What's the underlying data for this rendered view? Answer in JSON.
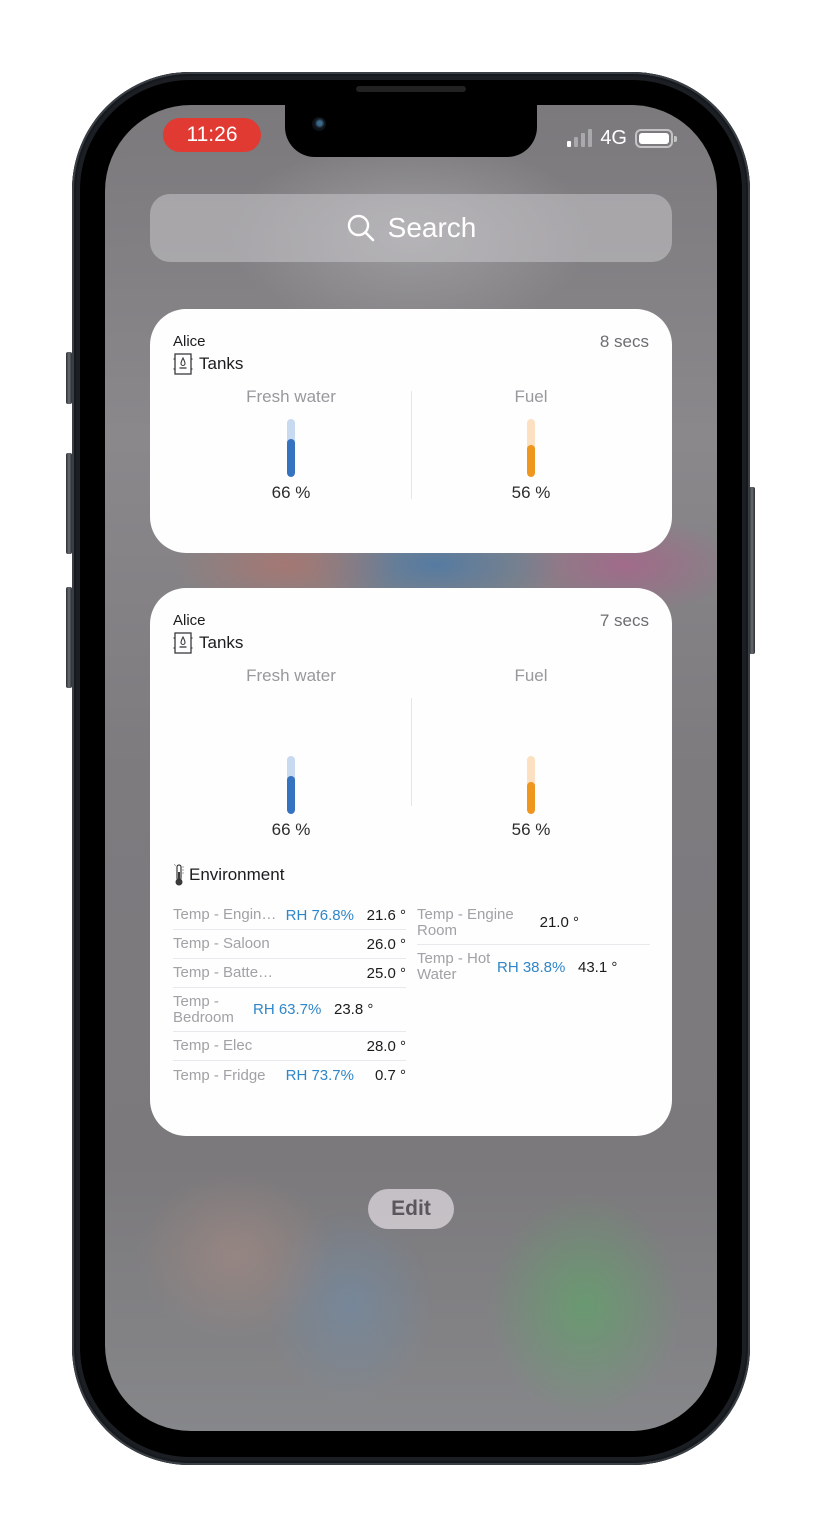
{
  "status_bar": {
    "time": "11:26",
    "network": "4G",
    "signal_bars_active": 1,
    "signal_bars_total": 4,
    "battery_level": 1.0
  },
  "search": {
    "placeholder": "Search",
    "icon": "search-icon"
  },
  "widgets": [
    {
      "user": "Alice",
      "age": "8 secs",
      "section": {
        "icon": "tank-icon",
        "title": "Tanks"
      },
      "tanks": [
        {
          "name": "Fresh water",
          "percent_label": "66 %",
          "level": 0.66,
          "color": "#3573c0",
          "track_color": "#c8daf0"
        },
        {
          "name": "Fuel",
          "percent_label": "56 %",
          "level": 0.56,
          "color": "#ef961f",
          "track_color": "#fce0c2"
        }
      ]
    },
    {
      "user": "Alice",
      "age": "7 secs",
      "section": {
        "icon": "tank-icon",
        "title": "Tanks"
      },
      "tanks": [
        {
          "name": "Fresh water",
          "percent_label": "66 %",
          "level": 0.66,
          "color": "#3573c0",
          "track_color": "#c8daf0"
        },
        {
          "name": "Fuel",
          "percent_label": "56 %",
          "level": 0.56,
          "color": "#ef961f",
          "track_color": "#fce0c2"
        }
      ],
      "environment": {
        "icon": "thermometer-icon",
        "title": "Environment",
        "left": [
          {
            "name": "Temp - Engin…",
            "rh": "RH 76.8%",
            "temp": "21.6 °"
          },
          {
            "name": "Temp - Saloon",
            "rh": "",
            "temp": "26.0 °"
          },
          {
            "name": "Temp - Batte…",
            "rh": "",
            "temp": "25.0 °"
          },
          {
            "name": "Temp - Bedroom",
            "rh": "RH 63.7%",
            "temp": "23.8 °"
          },
          {
            "name": "Temp - Elec",
            "rh": "",
            "temp": "28.0 °"
          },
          {
            "name": "Temp - Fridge",
            "rh": "RH 73.7%",
            "temp": "0.7 °"
          }
        ],
        "right": [
          {
            "name": "Temp - Engine Room",
            "rh": "",
            "temp": "21.0 °"
          },
          {
            "name": "Temp - Hot Water",
            "rh": "RH 38.8%",
            "temp": "43.1 °"
          }
        ]
      }
    }
  ],
  "edit_label": "Edit",
  "colors": {
    "accent_rh": "#2f86c8",
    "time_pill": "#e03a33"
  }
}
